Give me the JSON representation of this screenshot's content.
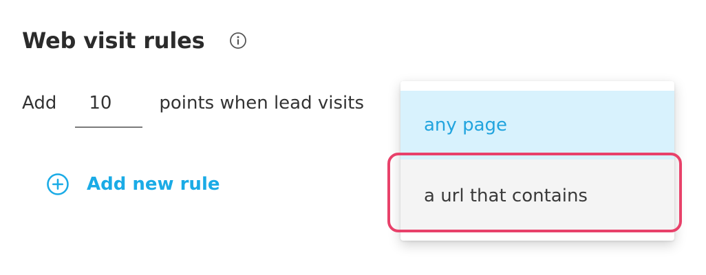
{
  "section": {
    "title": "Web visit rules",
    "info_icon": "info-circle-icon"
  },
  "rule": {
    "prefix": "Add",
    "points_value": "10",
    "suffix": "points when lead visits"
  },
  "add_rule": {
    "icon": "plus-circle-icon",
    "label": "Add new rule"
  },
  "dropdown": {
    "options": [
      {
        "label": "any page",
        "state": "selected"
      },
      {
        "label": "a url that contains",
        "state": "hovered"
      }
    ]
  },
  "colors": {
    "accent": "#1aabe6",
    "selected_bg": "#d8f2fd",
    "selected_text": "#21a4de",
    "hover_bg": "#f4f4f4",
    "highlight": "#e8416a",
    "heading": "#2b2b2b"
  }
}
